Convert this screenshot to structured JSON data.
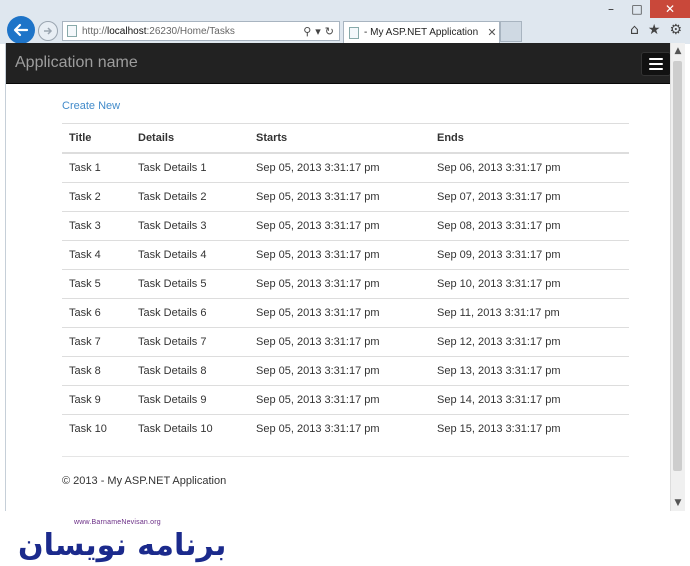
{
  "browser": {
    "address": "http://localhost:26230/Home/Tasks",
    "address_prefix": "http://",
    "address_host": "localhost",
    "address_rest": ":26230/Home/Tasks",
    "tab_title": "My ASP.NET Application",
    "tab_prefix": "- ",
    "controls": {
      "minimize": "–",
      "maximize": "□",
      "close": "✕"
    },
    "right_icons": [
      "home-icon",
      "star-icon",
      "gear-icon"
    ]
  },
  "navbar": {
    "brand": "Application name"
  },
  "page": {
    "create_new": "Create New",
    "table": {
      "headers": [
        "Title",
        "Details",
        "Starts",
        "Ends"
      ],
      "rows": [
        [
          "Task 1",
          "Task Details 1",
          "Sep 05, 2013 3:31:17 pm",
          "Sep 06, 2013 3:31:17 pm"
        ],
        [
          "Task 2",
          "Task Details 2",
          "Sep 05, 2013 3:31:17 pm",
          "Sep 07, 2013 3:31:17 pm"
        ],
        [
          "Task 3",
          "Task Details 3",
          "Sep 05, 2013 3:31:17 pm",
          "Sep 08, 2013 3:31:17 pm"
        ],
        [
          "Task 4",
          "Task Details 4",
          "Sep 05, 2013 3:31:17 pm",
          "Sep 09, 2013 3:31:17 pm"
        ],
        [
          "Task 5",
          "Task Details 5",
          "Sep 05, 2013 3:31:17 pm",
          "Sep 10, 2013 3:31:17 pm"
        ],
        [
          "Task 6",
          "Task Details 6",
          "Sep 05, 2013 3:31:17 pm",
          "Sep 11, 2013 3:31:17 pm"
        ],
        [
          "Task 7",
          "Task Details 7",
          "Sep 05, 2013 3:31:17 pm",
          "Sep 12, 2013 3:31:17 pm"
        ],
        [
          "Task 8",
          "Task Details 8",
          "Sep 05, 2013 3:31:17 pm",
          "Sep 13, 2013 3:31:17 pm"
        ],
        [
          "Task 9",
          "Task Details 9",
          "Sep 05, 2013 3:31:17 pm",
          "Sep 14, 2013 3:31:17 pm"
        ],
        [
          "Task 10",
          "Task Details 10",
          "Sep 05, 2013 3:31:17 pm",
          "Sep 15, 2013 3:31:17 pm"
        ]
      ]
    },
    "footer": "© 2013 - My ASP.NET Application"
  },
  "watermark": {
    "tagline": "www.BarnameNevisan.org",
    "mark": "برنامه نویسان"
  },
  "colors": {
    "link": "#428bca",
    "navbar": "#222222",
    "back_button": "#1e74c8",
    "close_button": "#c9483a",
    "logo": "#1b2a8c"
  }
}
